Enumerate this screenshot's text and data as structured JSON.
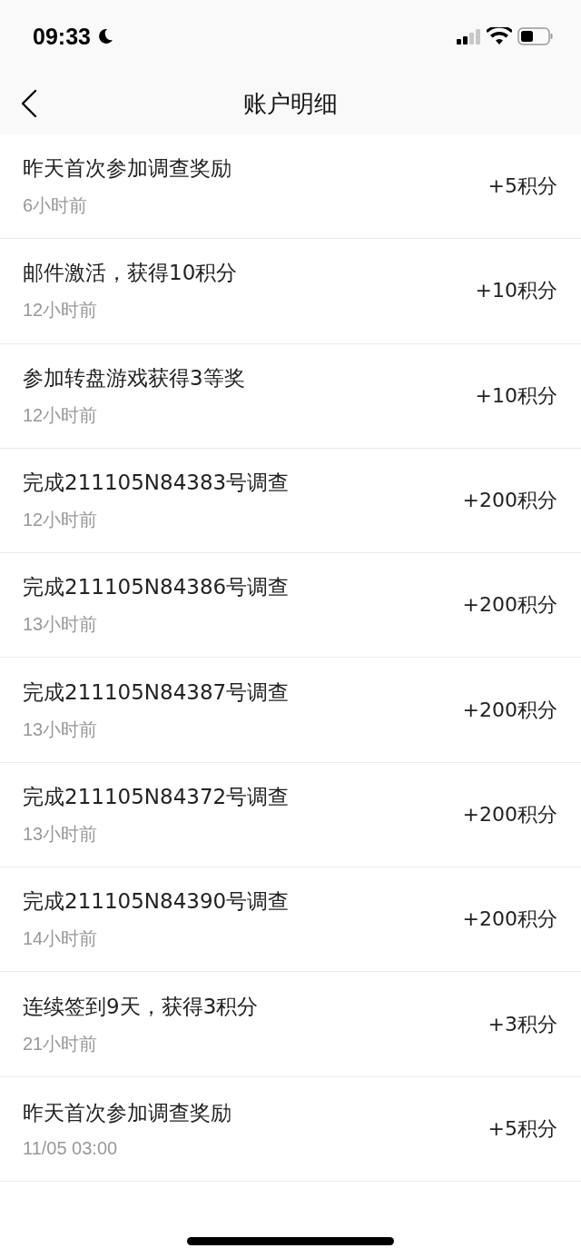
{
  "status_bar": {
    "time": "09:33"
  },
  "nav_bar": {
    "title": "账户明细"
  },
  "records": [
    {
      "title": "昨天首次参加调查奖励",
      "time": "6小时前",
      "amount": "+5积分"
    },
    {
      "title": "邮件激活，获得10积分",
      "time": "12小时前",
      "amount": "+10积分"
    },
    {
      "title": "参加转盘游戏获得3等奖",
      "time": "12小时前",
      "amount": "+10积分"
    },
    {
      "title": "完成211105N84383号调查",
      "time": "12小时前",
      "amount": "+200积分"
    },
    {
      "title": "完成211105N84386号调查",
      "time": "13小时前",
      "amount": "+200积分"
    },
    {
      "title": "完成211105N84387号调查",
      "time": "13小时前",
      "amount": "+200积分"
    },
    {
      "title": "完成211105N84372号调查",
      "time": "13小时前",
      "amount": "+200积分"
    },
    {
      "title": "完成211105N84390号调查",
      "time": "14小时前",
      "amount": "+200积分"
    },
    {
      "title": "连续签到9天，获得3积分",
      "time": "21小时前",
      "amount": "+3积分"
    },
    {
      "title": "昨天首次参加调查奖励",
      "time": "11/05 03:00",
      "amount": "+5积分"
    }
  ]
}
